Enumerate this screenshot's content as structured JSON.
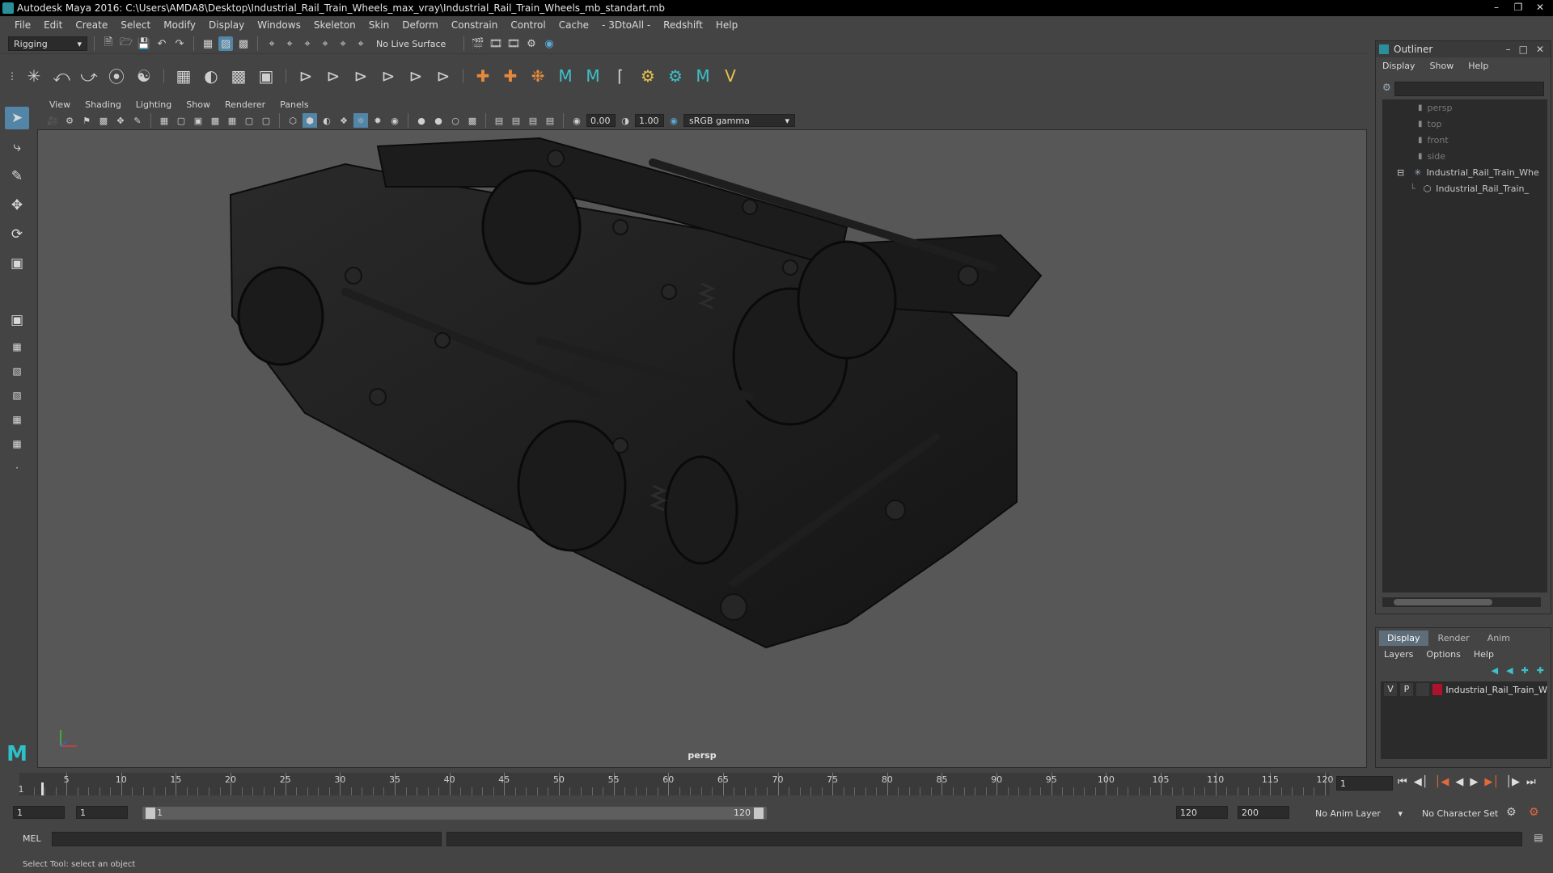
{
  "window": {
    "title": "Autodesk Maya 2016: C:\\Users\\AMDA8\\Desktop\\Industrial_Rail_Train_Wheels_max_vray\\Industrial_Rail_Train_Wheels_mb_standart.mb"
  },
  "menubar": [
    "File",
    "Edit",
    "Create",
    "Select",
    "Modify",
    "Display",
    "Windows",
    "Skeleton",
    "Skin",
    "Deform",
    "Constrain",
    "Control",
    "Cache",
    "- 3DtoAll -",
    "Redshift",
    "Help"
  ],
  "statusline": {
    "menu_set": "Rigging",
    "live_surface": "No Live Surface"
  },
  "panel": {
    "menus": [
      "View",
      "Shading",
      "Lighting",
      "Show",
      "Renderer",
      "Panels"
    ],
    "exposure": "0.00",
    "gamma": "1.00",
    "color_space": "sRGB gamma",
    "camera_label": "persp"
  },
  "outliner": {
    "title": "Outliner",
    "menus": [
      "Display",
      "Show",
      "Help"
    ],
    "items": [
      {
        "label": "persp",
        "type": "camera"
      },
      {
        "label": "top",
        "type": "camera"
      },
      {
        "label": "front",
        "type": "camera"
      },
      {
        "label": "side",
        "type": "camera"
      },
      {
        "label": "Industrial_Rail_Train_Whe",
        "type": "group"
      },
      {
        "label": "Industrial_Rail_Train_",
        "type": "mesh"
      }
    ]
  },
  "layers": {
    "tabs": [
      "Display",
      "Render",
      "Anim"
    ],
    "menus": [
      "Layers",
      "Options",
      "Help"
    ],
    "row": {
      "v": "V",
      "p": "P",
      "name": "Industrial_Rail_Train_W",
      "color": "#b0122e"
    }
  },
  "timeline": {
    "ticks": [
      "5",
      "10",
      "15",
      "20",
      "25",
      "30",
      "35",
      "40",
      "45",
      "50",
      "55",
      "60",
      "65",
      "70",
      "75",
      "80",
      "85",
      "90",
      "95",
      "100",
      "105",
      "110",
      "115",
      "120"
    ],
    "first_frame": "1",
    "current_frame": "1"
  },
  "range": {
    "start": "1",
    "playback_start": "1",
    "bar_start": "1",
    "bar_end": "120",
    "playback_end": "120",
    "end": "200",
    "anim_layer": "No Anim Layer",
    "character_set": "No Character Set"
  },
  "cmdline": {
    "label": "MEL"
  },
  "helpline": {
    "text": "Select Tool: select an object"
  },
  "colors": {
    "accent": "#5285a6",
    "maya_teal": "#2ec0c8"
  }
}
